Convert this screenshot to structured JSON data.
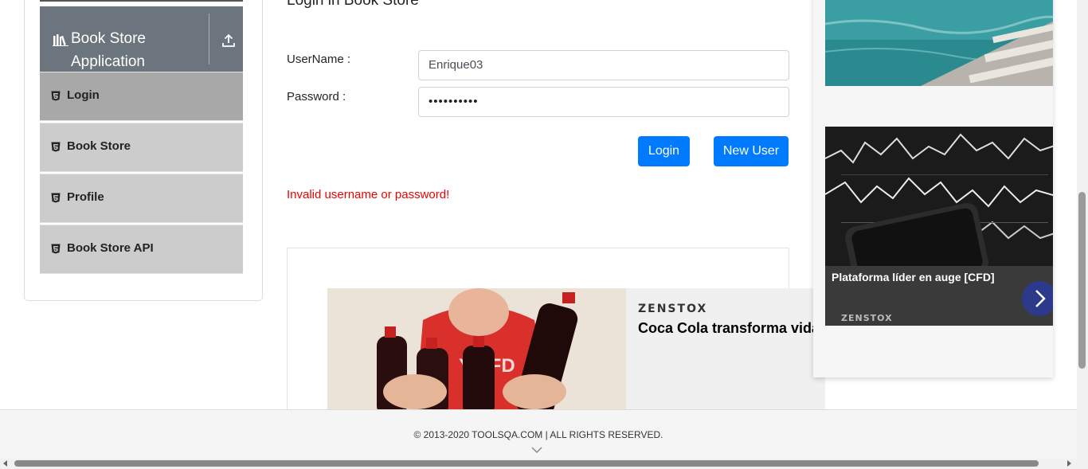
{
  "sidebar": {
    "group_title": "Book Store Application",
    "group_icon": "books-icon",
    "toggle_icon": "upload-icon",
    "items": [
      {
        "label": "Login",
        "icon": "html5-icon",
        "active": true
      },
      {
        "label": "Book Store",
        "icon": "html5-icon",
        "active": false
      },
      {
        "label": "Profile",
        "icon": "html5-icon",
        "active": false
      },
      {
        "label": "Book Store API",
        "icon": "html5-icon",
        "active": false
      }
    ]
  },
  "form": {
    "heading": "Login in Book Store",
    "username_label": "UserName :",
    "username_value": "Enrique03",
    "password_label": "Password :",
    "password_value": "••••••••••",
    "login_button": "Login",
    "new_user_button": "New User",
    "error_message": "Invalid username or password!"
  },
  "ad_banner": {
    "brand": "ZENSTOX",
    "headline": "Coca Cola transforma vida"
  },
  "side_ad": {
    "caption": "Plataforma líder en auge [CFD]",
    "brand": "ZENSTOX",
    "arrow_icon": "chevron-right-icon"
  },
  "footer": {
    "copyright": "© 2013-2020 TOOLSQA.COM | ALL RIGHTS RESERVED."
  },
  "colors": {
    "primary": "#007bff",
    "error": "#e00000",
    "sidebar_header": "#6c757d",
    "menu_active": "#a8a8a8",
    "menu_item": "#cccccc"
  }
}
